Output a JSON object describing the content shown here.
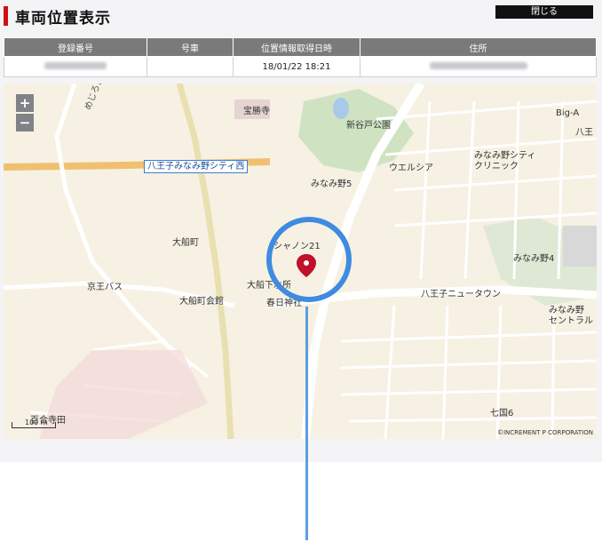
{
  "header": {
    "title": "車両位置表示",
    "close_label": "閉じる"
  },
  "info_table": {
    "columns": [
      "登録番号",
      "号車",
      "位置情報取得日時",
      "住所"
    ],
    "row": {
      "registration": "",
      "car_no": "",
      "datetime": "18/01/22 18:21",
      "address": ""
    }
  },
  "map": {
    "zoom_in": "+",
    "zoom_out": "−",
    "highway_label": "八王子みなみ野シティ西",
    "labels": [
      {
        "name": "label-houshouji",
        "text": "宝勝寺"
      },
      {
        "name": "label-shinyato-park",
        "text": "新谷戸公園"
      },
      {
        "name": "label-big-a",
        "text": "Big-A"
      },
      {
        "name": "label-hachiouji-ne",
        "text": "八王"
      },
      {
        "name": "label-minamino-clinic-1",
        "text": "みなみ野シティ"
      },
      {
        "name": "label-minamino-clinic-2",
        "text": "クリニック"
      },
      {
        "name": "label-welcia",
        "text": "ウエルシア"
      },
      {
        "name": "label-minamino5",
        "text": "みなみ野5"
      },
      {
        "name": "label-oofunemachi",
        "text": "大船町"
      },
      {
        "name": "label-shanon21",
        "text": "シャノン21"
      },
      {
        "name": "label-minamino4",
        "text": "みなみ野4"
      },
      {
        "name": "label-keio-bus",
        "text": "京王バス"
      },
      {
        "name": "label-oofune-kaikan",
        "text": "大船町会館"
      },
      {
        "name": "label-oofune-water",
        "text": "大船下水所"
      },
      {
        "name": "label-kasuga-shrine",
        "text": "春日神社"
      },
      {
        "name": "label-newtown",
        "text": "八王子ニュータウン"
      },
      {
        "name": "label-minamino-central-1",
        "text": "みなみ野"
      },
      {
        "name": "label-minamino-central-2",
        "text": "セントラル"
      },
      {
        "name": "label-nanakuni6",
        "text": "七国6"
      },
      {
        "name": "label-momodai",
        "text": "百合寺田"
      },
      {
        "name": "label-greenhill",
        "text": "めじろ台グリーンヒル通り"
      }
    ],
    "scale_label": "100 m",
    "copyright": "©INCREMENT P CORPORATION"
  }
}
